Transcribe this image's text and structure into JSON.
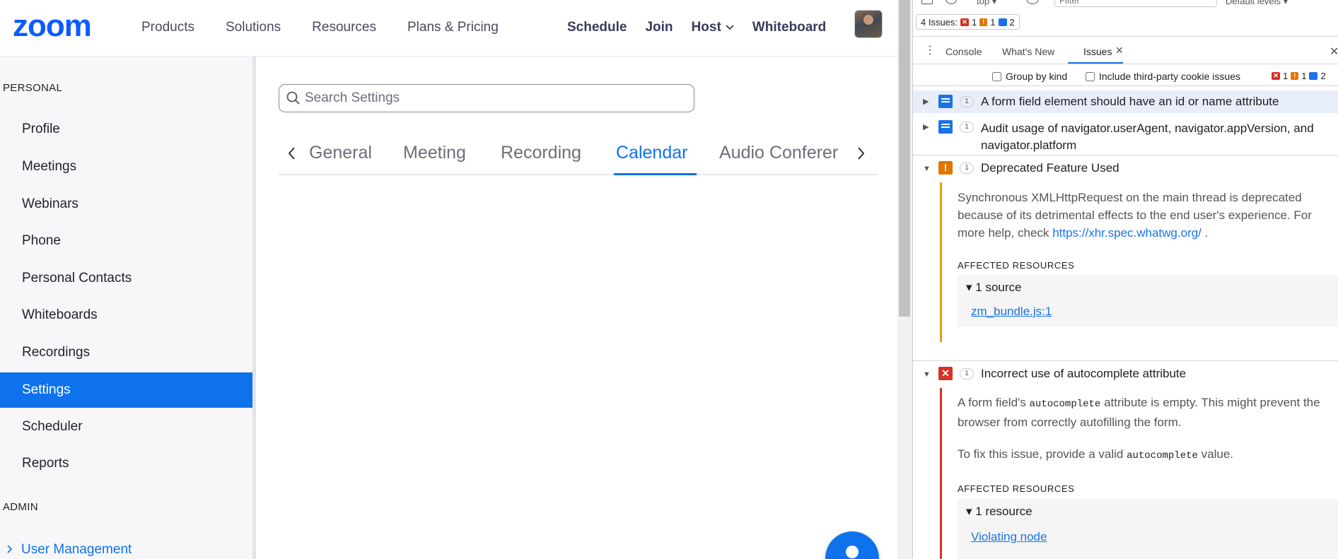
{
  "colors": {
    "brand": "#0b5cff",
    "accent": "#0e72ed",
    "devtools_info": "#1a73e8",
    "devtools_warning": "#e37400",
    "devtools_error": "#d93025"
  },
  "topnav": {
    "logo": "zoom",
    "left_links": [
      "Products",
      "Solutions",
      "Resources",
      "Plans & Pricing"
    ],
    "schedule": "Schedule",
    "join": "Join",
    "host": "Host",
    "whiteboard": "Whiteboard"
  },
  "sidebar": {
    "personal_heading": "PERSONAL",
    "items": [
      {
        "label": "Profile"
      },
      {
        "label": "Meetings"
      },
      {
        "label": "Webinars"
      },
      {
        "label": "Phone"
      },
      {
        "label": "Personal Contacts"
      },
      {
        "label": "Whiteboards"
      },
      {
        "label": "Recordings"
      },
      {
        "label": "Settings",
        "active": true
      },
      {
        "label": "Scheduler"
      },
      {
        "label": "Reports"
      }
    ],
    "admin_heading": "ADMIN",
    "admin_items": [
      {
        "label": "User Management"
      }
    ]
  },
  "main": {
    "search_placeholder": "Search Settings",
    "tabs": [
      {
        "label": "General"
      },
      {
        "label": "Meeting"
      },
      {
        "label": "Recording"
      },
      {
        "label": "Calendar",
        "active": true
      },
      {
        "label": "Audio Conferer"
      }
    ]
  },
  "devtools": {
    "top": {
      "context": "top",
      "filter_placeholder": "Filter",
      "levels": "Default levels",
      "issues_label": "4 Issues:",
      "err_count": "1",
      "warn_count": "1",
      "info_count": "2"
    },
    "tabs": [
      {
        "label": "Console"
      },
      {
        "label": "What's New"
      },
      {
        "label": "Issues",
        "active": true
      }
    ],
    "toolbar": {
      "group_by_kind": "Group by kind",
      "third_party": "Include third-party cookie issues",
      "err_count": "1",
      "warn_count": "1",
      "info_count": "2"
    },
    "issues": [
      {
        "count": "1",
        "title": "A form field element should have an id or name attribute"
      },
      {
        "count": "1",
        "title": "Audit usage of navigator.userAgent, navigator.appVersion, and navigator.platform"
      },
      {
        "count": "1",
        "title": "Deprecated Feature Used",
        "detail_1": "Synchronous XMLHttpRequest on the main thread is deprecated because of its detrimental effects to the end user's experience. For more help, check",
        "link": "https://xhr.spec.whatwg.org/",
        "detail_end": ".",
        "affected": "AFFECTED RESOURCES",
        "resource_head": "1 source",
        "resource_link": "zm_bundle.js:1"
      },
      {
        "count": "1",
        "title": "Incorrect use of autocomplete attribute",
        "detail_a": "A form field's",
        "detail_code": "autocomplete",
        "detail_b": "attribute is empty. This might prevent the browser from correctly autofilling the form.",
        "fix_a": "To fix this issue, provide a valid",
        "fix_code": "autocomplete",
        "fix_b": "value.",
        "affected": "AFFECTED RESOURCES",
        "resource_head": "1 resource",
        "resource_link": "Violating node"
      }
    ]
  }
}
